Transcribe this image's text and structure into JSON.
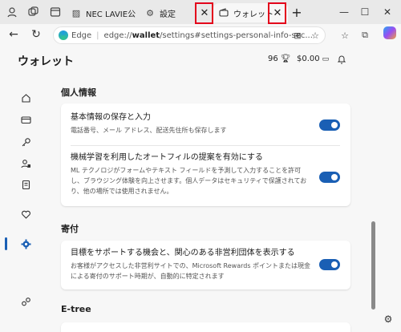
{
  "tabs": [
    {
      "label": "NEC LAVIE公"
    },
    {
      "label": "設定"
    },
    {
      "label": "ウォレット"
    }
  ],
  "new_tab_symbol": "+",
  "address": {
    "brand": "Edge",
    "url_prefix": "edge://",
    "url_bold": "wallet",
    "url_suffix": "/settings#settings-personal-info-sec..."
  },
  "header": {
    "title": "ウォレット",
    "points": "96",
    "balance": "$0.00"
  },
  "sections": [
    {
      "title": "個人情報",
      "rows": [
        {
          "title": "基本情報の保存と入力",
          "desc": "電話番号、メール アドレス、配送先住所も保存します",
          "enabled": true
        },
        {
          "title": "機械学習を利用したオートフィルの提案を有効にする",
          "desc": "ML テクノロジがフォームやテキスト フィールドを予測して入力することを許可し、ブラウジング体験を向上させます。個人データはセキュリティで保護されており、他の場所では使用されません。",
          "enabled": true
        }
      ]
    },
    {
      "title": "寄付",
      "rows": [
        {
          "title": "目標をサポートする機会と、関心のある非営利団体を表示する",
          "desc": "お客様がアクセスした非営利サイトでの、Microsoft Rewards ポイントまたは現金による寄付のサポート時期が、自動的に特定されます",
          "enabled": true
        }
      ]
    },
    {
      "title": "E-tree",
      "rows": []
    }
  ],
  "colors": {
    "accent": "#1a5fb4",
    "highlight": "#e3001b"
  }
}
